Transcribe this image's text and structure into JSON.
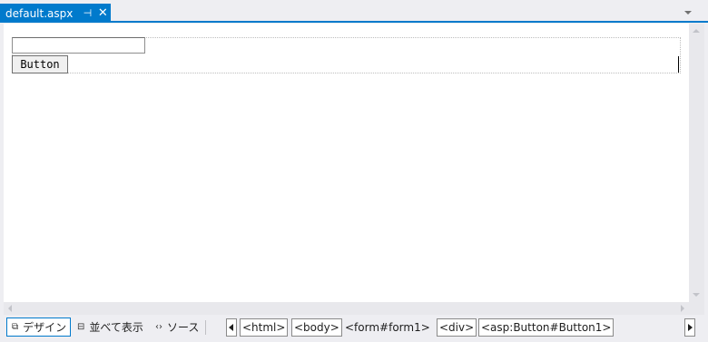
{
  "document_tab": {
    "title": "default.aspx",
    "pin_glyph": "⊣",
    "close_glyph": "✕"
  },
  "design": {
    "button_text": "Button",
    "textbox_value": ""
  },
  "view_tabs": [
    {
      "label": "デザイン",
      "icon": "design-view-icon",
      "active": true
    },
    {
      "label": "並べて表示",
      "icon": "split-view-icon",
      "active": false
    },
    {
      "label": "ソース",
      "icon": "source-view-icon",
      "active": false
    }
  ],
  "breadcrumb": [
    "<html>",
    "<body>",
    "<form#form1>",
    "<div>",
    "<asp:Button#Button1>"
  ],
  "colors": {
    "accent": "#007acc",
    "chrome": "#eeeef2",
    "surface": "#ffffff"
  }
}
